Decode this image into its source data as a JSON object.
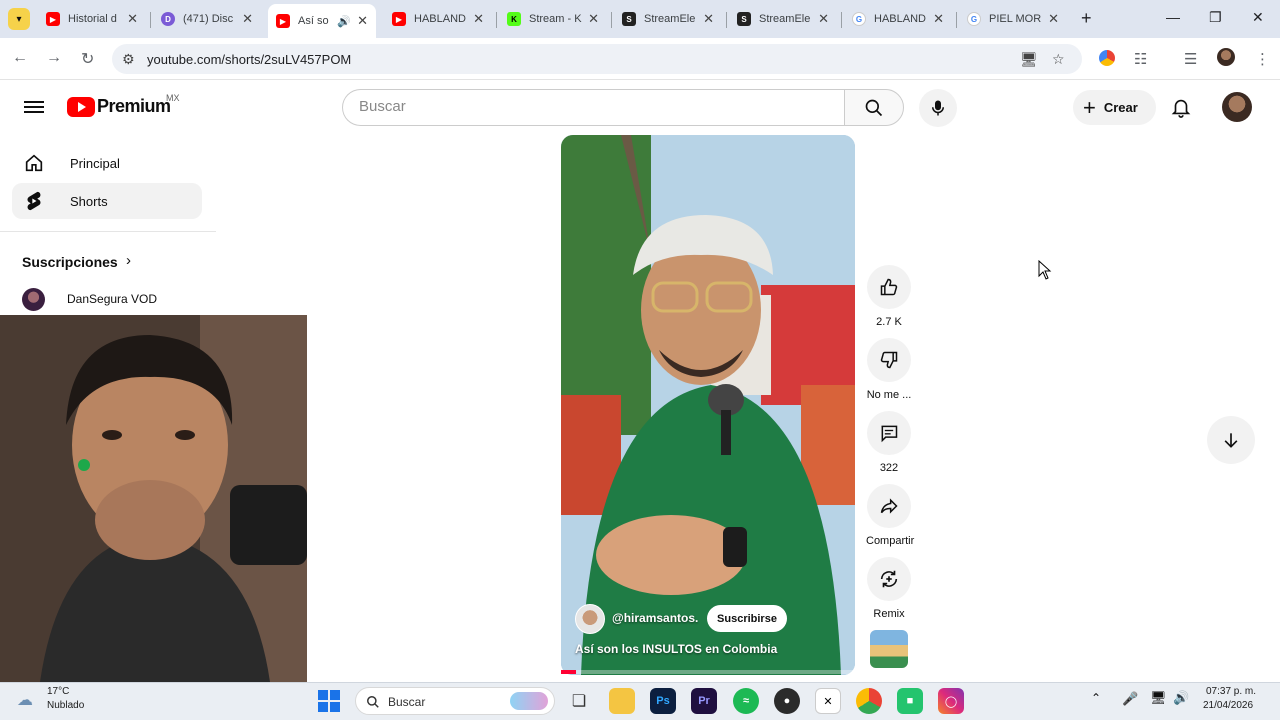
{
  "browser": {
    "tabs": [
      {
        "title": "Historial d",
        "favicon": "youtube-favicon",
        "color": "#ff0000"
      },
      {
        "title": "(471) Disc",
        "favicon": "discord-favicon",
        "color": "#7b5bd6"
      },
      {
        "title": "Así so",
        "favicon": "youtube-favicon",
        "color": "#ff0000",
        "active": true
      },
      {
        "title": "HABLAND",
        "favicon": "youtube-favicon",
        "color": "#ff0000"
      },
      {
        "title": "Stream - K",
        "favicon": "kick-favicon",
        "color": "#53fc18"
      },
      {
        "title": "StreamEle",
        "favicon": "streamelements-favicon",
        "color": "#222222"
      },
      {
        "title": "StreamEle",
        "favicon": "streamelements-favicon",
        "color": "#222222"
      },
      {
        "title": "HABLAND",
        "favicon": "google-favicon",
        "color": "#4285f4"
      },
      {
        "title": "PIEL MOR",
        "favicon": "google-favicon",
        "color": "#4285f4"
      }
    ],
    "new_tab_label": "+",
    "url": "youtube.com/shorts/2suLV457POM"
  },
  "youtube": {
    "logo_text": "Premium",
    "region": "MX",
    "search_placeholder": "Buscar",
    "create_label": "Crear",
    "sidebar": {
      "items": [
        {
          "label": "Principal",
          "icon": "home-icon",
          "selected": false
        },
        {
          "label": "Shorts",
          "icon": "shorts-icon",
          "selected": true
        }
      ],
      "subscriptions_title": "Suscripciones",
      "subscriptions": [
        {
          "name": "DanSegura VOD"
        }
      ]
    },
    "short": {
      "channel": "@hiramsantos.",
      "subscribe_label": "Suscribirse",
      "title": "Así son los INSULTOS en Colombia",
      "progress": 0.05
    },
    "actions": {
      "like_count": "2.7 K",
      "dislike_label": "No me ...",
      "comment_count": "322",
      "share_label": "Compartir",
      "remix_label": "Remix"
    }
  },
  "taskbar": {
    "weather_temp": "17°C",
    "weather_desc": "Nublado",
    "search_label": "Buscar",
    "time": "07:37 p. m.",
    "date": "21/04/2026"
  },
  "colors": {
    "youtube_red": "#ff0000",
    "progress_red": "#ff0033",
    "tabstrip": "#dfe5f0"
  }
}
